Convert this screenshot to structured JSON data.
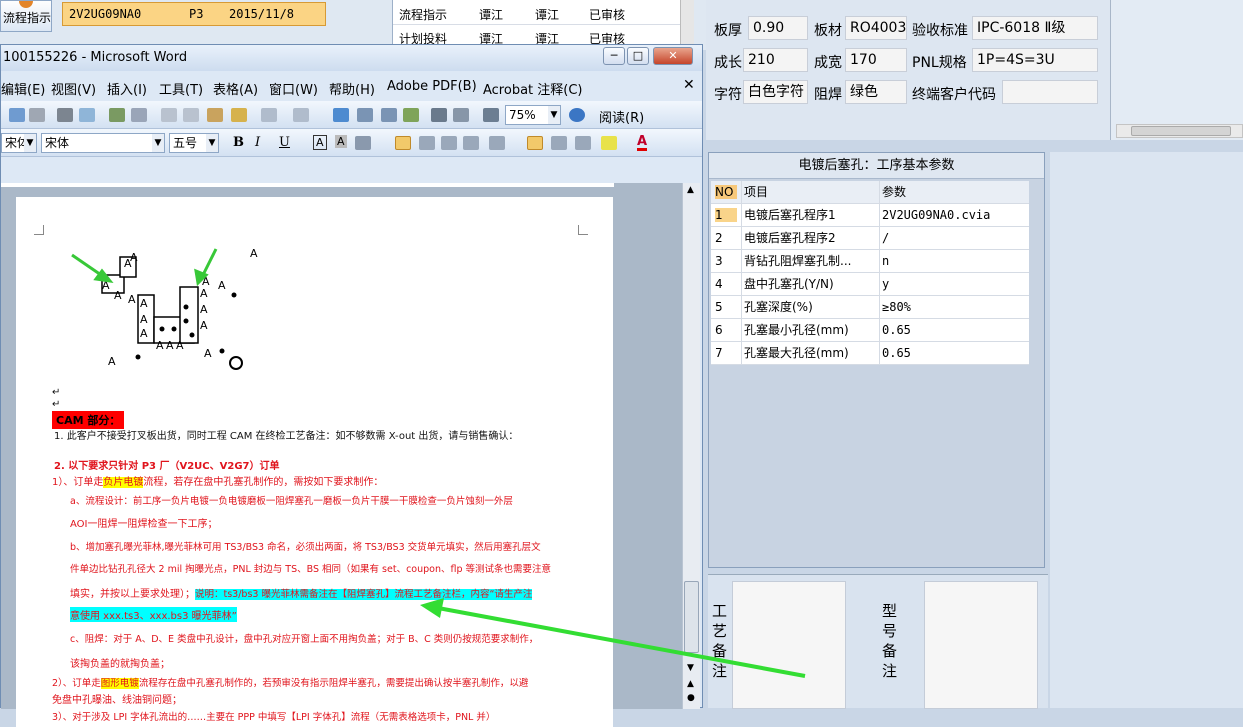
{
  "bg_app": {
    "flow_button": "流程指示",
    "selected_row": {
      "code": "2V2UG09NA0",
      "plant": "P3",
      "date": "2015/11/8"
    },
    "flow_rows": [
      {
        "item": "流程指示",
        "p1": "谭江",
        "p2": "谭江",
        "status": "已审核"
      },
      {
        "item": "计划投料",
        "p1": "谭江",
        "p2": "谭江",
        "status": "已审核"
      }
    ]
  },
  "specs": {
    "board_thickness_label": "板厚",
    "board_thickness": "0.90",
    "material_label": "板材",
    "material": "RO4003C",
    "acceptance_label": "验收标准",
    "acceptance": "IPC-6018 Ⅱ级",
    "length_label": "成长",
    "length": "210",
    "width_label": "成宽",
    "width": "170",
    "pnl_label": "PNL规格",
    "pnl": "1P=4S=3U",
    "legend_label": "字符",
    "legend": "白色字符",
    "mask_label": "阻焊",
    "mask": "绿色",
    "customer_code_label": "终端客户代码",
    "customer_code": ""
  },
  "params": {
    "title": "电镀后塞孔：工序基本参数",
    "headers": {
      "no": "NO",
      "item": "项目",
      "value": "参数"
    },
    "rows": [
      {
        "no": "1",
        "item": "电镀后塞孔程序1",
        "value": "2V2UG09NA0.cvia"
      },
      {
        "no": "2",
        "item": "电镀后塞孔程序2",
        "value": "/"
      },
      {
        "no": "3",
        "item": "背钻孔阻焊塞孔制...",
        "value": "n"
      },
      {
        "no": "4",
        "item": "盘中孔塞孔(Y/N)",
        "value": "y"
      },
      {
        "no": "5",
        "item": "孔塞深度(%)",
        "value": "≥80%"
      },
      {
        "no": "6",
        "item": "孔塞最小孔径(mm)",
        "value": "0.65"
      },
      {
        "no": "7",
        "item": "孔塞最大孔径(mm)",
        "value": "0.65"
      }
    ]
  },
  "remarks": {
    "process": "工艺备注",
    "model": "型号备注"
  },
  "word": {
    "title": "100155226 - Microsoft Word",
    "menu": [
      "编辑(E)",
      "视图(V)",
      "插入(I)",
      "工具(T)",
      "表格(A)",
      "窗口(W)",
      "帮助(H)",
      "Adobe PDF(B)",
      "Acrobat 注释(C)"
    ],
    "zoom": "75%",
    "read_mode": "阅读(R)",
    "style": "宋体",
    "font": "宋体",
    "size": "五号",
    "bold": "B",
    "italic": "I",
    "underline": "U",
    "char_a": "A"
  },
  "doc": {
    "cam_label": "CAM 部分：",
    "l1": "1.    此客户不接受打叉板出货，同时工程 CAM 在终检工艺备注：如不够数需 X-out 出货，请与销售确认：",
    "l2": "2.    以下要求只针对 P3 厂（V2UC、V2G7）订单",
    "l3a": "1）、订单走",
    "l3b": "负片电镀",
    "l3c": "流程，若存在盘中孔塞孔制作的，需按如下要求制作：",
    "l4": "a、流程设计：前工序一负片电镀一负电镀磨板一阻焊塞孔一磨板一负片干膜一干膜检查一负片蚀刻一外层",
    "l5": "AOI一阻焊一阻焊检查一下工序；",
    "l6": "b、增加塞孔曝光菲林,曝光菲林可用 TS3/BS3 命名，必须出两面，将 TS3/BS3 交货单元填实，然后用塞孔层文",
    "l7": "件单边比钻孔孔径大 2 mil 掏曝光点，PNL 封边与 TS、BS 相同（如果有 set、coupon、flp 等测试条也需要注意",
    "l8a": "填实，并按以上要求处理）；",
    "l8b": "说明：ts3/bs3 曝光菲林需备注在【阻焊塞孔】流程工艺备注栏，内容“请生产注",
    "l9": "意使用 xxx.ts3、xxx.bs3 曝光菲林”",
    "l10": "c、阻焊：对于 A、D、E 类盘中孔设计，盘中孔对应开窗上面不用掏负盖；对于 B、C 类则仍按规范要求制作，",
    "l11": "该掏负盖的就掏负盖；",
    "l12a": "2）、订单走",
    "l12b": "图形电镀",
    "l12c": "流程存在盘中孔塞孔制作的，若预审没有指示阻焊半塞孔，需要提出确认按半塞孔制作，以避",
    "l13": "免盘中孔曝油、线油铜问题；",
    "l14": "3）、对于涉及 LPI 字体孔流出的……主要在 PPP 中填写【LPI 字体孔】流程（无需表格选项卡，PNL 并）",
    "symbol": "A"
  }
}
